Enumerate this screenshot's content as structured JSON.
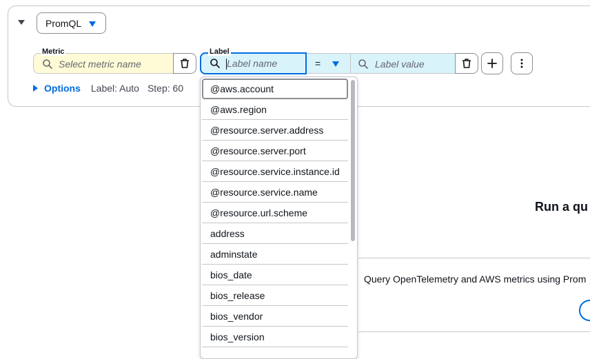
{
  "query_editor": {
    "language_label": "PromQL",
    "metric": {
      "label": "Metric",
      "placeholder": "Select metric name"
    },
    "label_filter": {
      "label": "Label",
      "name_placeholder": "Label name",
      "operator": "=",
      "value_placeholder": "Label value"
    },
    "options": {
      "link_label": "Options",
      "label_setting": "Label: Auto",
      "step_setting": "Step: 60"
    }
  },
  "dropdown": {
    "items": [
      "@aws.account",
      "@aws.region",
      "@resource.server.address",
      "@resource.server.port",
      "@resource.service.instance.id",
      "@resource.service.name",
      "@resource.url.scheme",
      "address",
      "adminstate",
      "bios_date",
      "bios_release",
      "bios_vendor",
      "bios_version"
    ],
    "selected_index": 0
  },
  "empty_state": {
    "title": "Run a qu",
    "description": "Query OpenTelemetry and AWS metrics using Prom"
  },
  "colors": {
    "accent": "#006ce0",
    "metric_bg": "#fffbd6",
    "label_bg": "#d9f3fb",
    "border": "#c6c6cd"
  },
  "icons": {
    "collapse": "caret-down-icon",
    "search": "search-icon",
    "delete": "trash-icon",
    "add": "plus-icon",
    "more": "vertical-ellipsis-icon"
  }
}
